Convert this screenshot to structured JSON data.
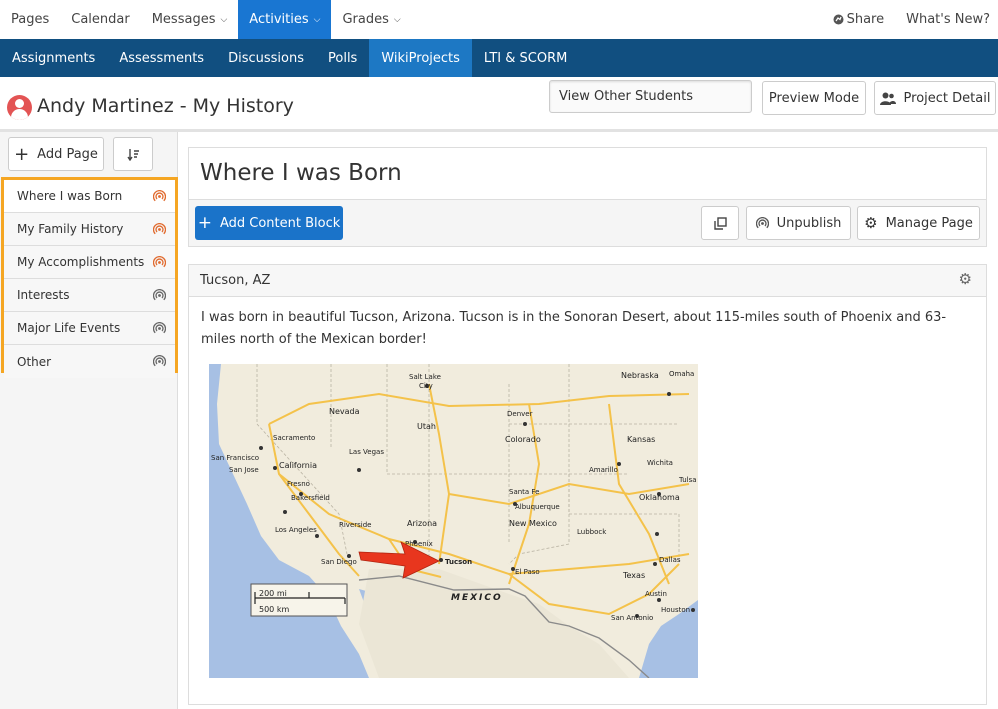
{
  "top_nav": {
    "items": [
      {
        "label": "Pages",
        "caret": false
      },
      {
        "label": "Calendar",
        "caret": false
      },
      {
        "label": "Messages",
        "caret": true
      },
      {
        "label": "Activities",
        "caret": true,
        "active": true
      },
      {
        "label": "Grades",
        "caret": true
      }
    ],
    "share_icon": "share-icon",
    "share_label": "Share",
    "whats_new_label": "What's New?"
  },
  "sub_nav": {
    "items": [
      "Assignments",
      "Assessments",
      "Discussions",
      "Polls",
      "WikiProjects",
      "LTI & SCORM"
    ],
    "active": "WikiProjects"
  },
  "header": {
    "title": "Andy Martinez - My History",
    "view_other_students": "View Other Students",
    "preview_mode": "Preview Mode",
    "project_detail": "Project Detail"
  },
  "sidebar": {
    "add_page_label": "Add Page",
    "pages": [
      {
        "label": "Where I was Born",
        "published": true
      },
      {
        "label": "My Family History",
        "published": true
      },
      {
        "label": "My Accomplishments",
        "published": true
      },
      {
        "label": "Interests",
        "published": false
      },
      {
        "label": "Major Life Events",
        "published": false
      },
      {
        "label": "Other",
        "published": false
      }
    ]
  },
  "page": {
    "title": "Where I was Born",
    "add_content_block": "Add Content Block",
    "unpublish": "Unpublish",
    "manage_page": "Manage Page"
  },
  "content_block": {
    "title": "Tucson, AZ",
    "text": "I was born in beautiful Tucson, Arizona. Tucson is in the Sonoran Desert, about 115-miles south of Phoenix and 63-miles north of the Mexican border!",
    "map": {
      "labels": [
        "Salt Lake City",
        "Nevada",
        "Utah",
        "Colorado",
        "Kansas",
        "Nebraska",
        "Omaha",
        "Denver",
        "Sacramento",
        "San Francisco",
        "San Jose",
        "California",
        "Fresno",
        "Bakersfield",
        "Las Vegas",
        "Los Angeles",
        "San Diego",
        "Riverside",
        "Phoenix",
        "Arizona",
        "Tucson",
        "New Mexico",
        "Albuquerque",
        "Santa Fe",
        "El Paso",
        "Oklahoma",
        "Dallas",
        "Texas",
        "Austin",
        "Houston",
        "San Antonio",
        "MEXICO",
        "Wichita",
        "Amarillo",
        "Lubbock",
        "Tulsa"
      ],
      "scale_mi": "200 mi",
      "scale_km": "500 km",
      "colors": {
        "land": "#f1ecdd",
        "water": "#a7c0e4",
        "road": "#f4c24a",
        "arrow": "#e8361e"
      }
    }
  },
  "colors": {
    "accent": "#1976d2",
    "subnav": "#114f80",
    "highlight": "#f5a623",
    "published": "#e06a2e"
  }
}
